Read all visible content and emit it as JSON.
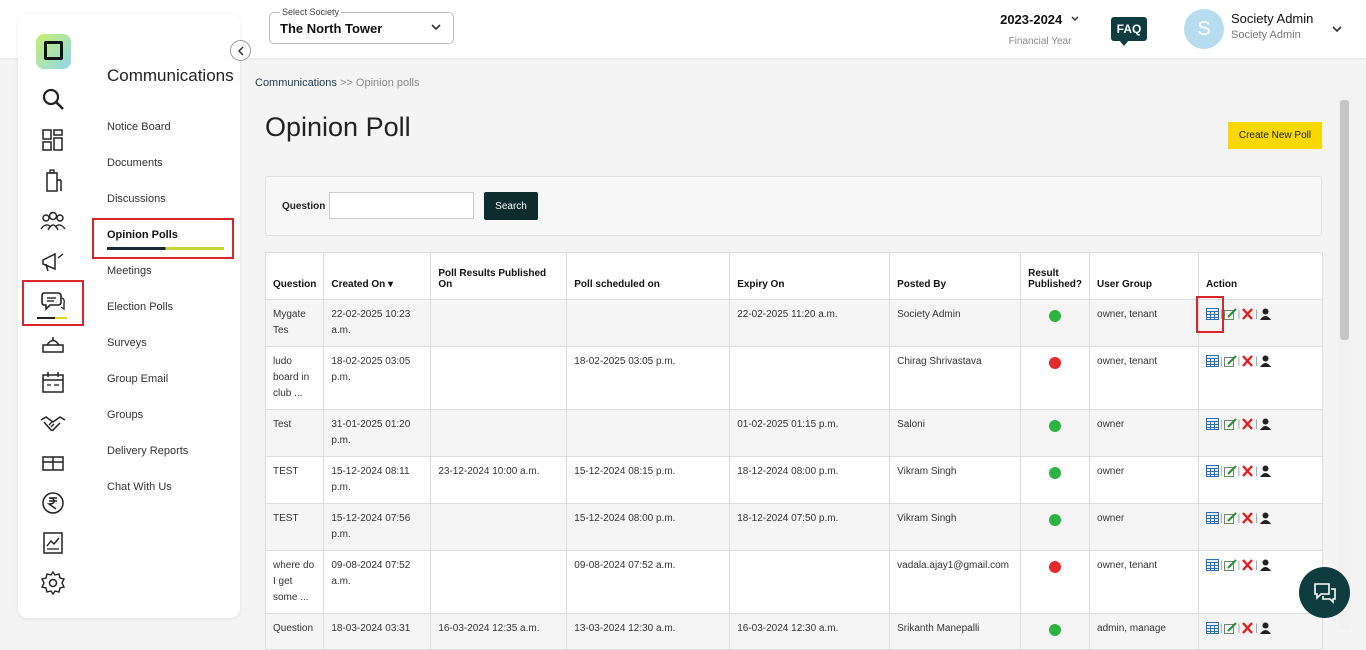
{
  "header": {
    "society_label": "Select Society",
    "society_value": "The North Tower",
    "fy_year": "2023-2024",
    "fy_label": "Financial Year",
    "faq": "FAQ",
    "avatar_letter": "S",
    "user_name": "Society Admin",
    "user_role": "Society Admin"
  },
  "rail_icons": [
    "search-icon",
    "dashboard-icon",
    "building-icon",
    "people-icon",
    "megaphone-icon",
    "communication-icon",
    "helpdesk-icon",
    "calendar-icon",
    "handshake-icon",
    "facility-icon",
    "rupee-icon",
    "report-icon",
    "settings-icon"
  ],
  "sidebar": {
    "title": "Communications",
    "items": [
      {
        "label": "Notice Board"
      },
      {
        "label": "Documents"
      },
      {
        "label": "Discussions"
      },
      {
        "label": "Opinion Polls"
      },
      {
        "label": "Meetings"
      },
      {
        "label": "Election Polls"
      },
      {
        "label": "Surveys"
      },
      {
        "label": "Group Email"
      },
      {
        "label": "Groups"
      },
      {
        "label": "Delivery Reports"
      },
      {
        "label": "Chat With Us"
      }
    ]
  },
  "breadcrumb": {
    "parent": "Communications",
    "sep": ">>",
    "current": "Opinion polls"
  },
  "page": {
    "title": "Opinion Poll",
    "create_button": "Create New Poll"
  },
  "search": {
    "label": "Question",
    "value": "",
    "button": "Search"
  },
  "table": {
    "headers": [
      "Question",
      "Created On ▾",
      "Poll Results Published On",
      "Poll scheduled on",
      "Expiry On",
      "Posted By",
      "Result Published?",
      "User Group",
      "Action"
    ],
    "rows": [
      {
        "question": "Mygate Tes",
        "created": "22-02-2025 10:23 a.m.",
        "published_on": "",
        "scheduled": "",
        "expiry": "22-02-2025 11:20 a.m.",
        "posted_by": "Society Admin",
        "result": "ok",
        "group": "owner, tenant"
      },
      {
        "question": "ludo board in club ...",
        "created": "18-02-2025 03:05 p.m.",
        "published_on": "",
        "scheduled": "18-02-2025 03:05 p.m.",
        "expiry": "",
        "posted_by": "Chirag Shrivastava",
        "result": "no",
        "group": "owner, tenant"
      },
      {
        "question": "Test",
        "created": "31-01-2025 01:20 p.m.",
        "published_on": "",
        "scheduled": "",
        "expiry": "01-02-2025 01:15 p.m.",
        "posted_by": "Saloni",
        "result": "ok",
        "group": "owner"
      },
      {
        "question": "TEST",
        "created": "15-12-2024 08:11 p.m.",
        "published_on": "23-12-2024 10:00 a.m.",
        "scheduled": "15-12-2024 08:15 p.m.",
        "expiry": "18-12-2024 08:00 p.m.",
        "posted_by": "Vikram Singh",
        "result": "ok",
        "group": "owner"
      },
      {
        "question": "TEST",
        "created": "15-12-2024 07:56 p.m.",
        "published_on": "",
        "scheduled": "15-12-2024 08:00 p.m.",
        "expiry": "18-12-2024 07:50 p.m.",
        "posted_by": "Vikram Singh",
        "result": "ok",
        "group": "owner"
      },
      {
        "question": "where do I get some ...",
        "created": "09-08-2024 07:52 a.m.",
        "published_on": "",
        "scheduled": "09-08-2024 07:52 a.m.",
        "expiry": "",
        "posted_by": "vadala.ajay1@gmail.com",
        "result": "no",
        "group": "owner, tenant"
      },
      {
        "question": "Question",
        "created": "18-03-2024 03:31",
        "published_on": "16-03-2024 12:35 a.m.",
        "scheduled": "13-03-2024 12:30 a.m.",
        "expiry": "16-03-2024 12:30 a.m.",
        "posted_by": "Srikanth Manepalli",
        "result": "ok",
        "group": "admin, manage"
      }
    ]
  },
  "colors": {
    "brand_dark": "#0e3c3f",
    "accent_yellow": "#f8d800",
    "highlight_red": "#d9262c",
    "ok_green": "#2db33f",
    "no_red": "#e42b2b"
  }
}
